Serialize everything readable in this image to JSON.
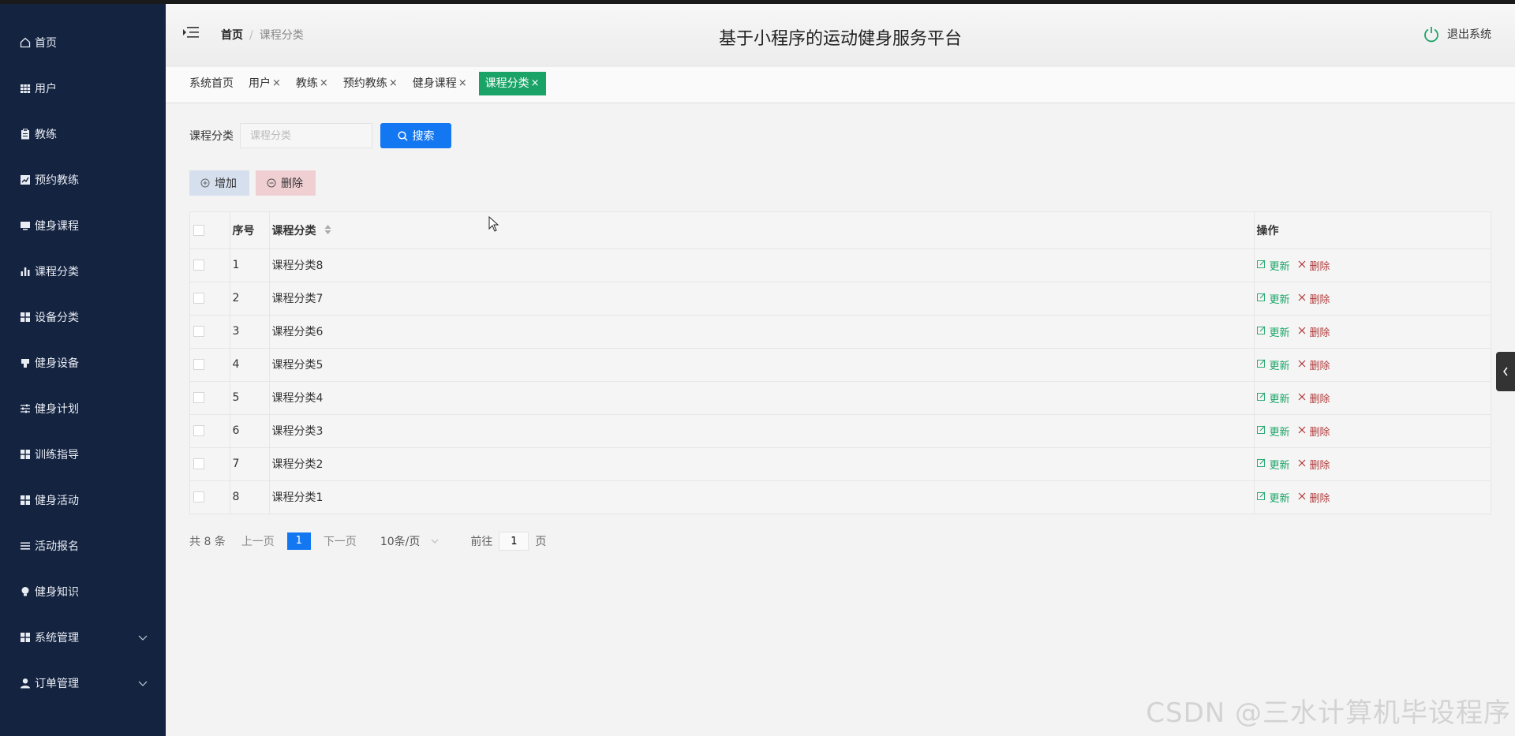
{
  "app_title": "基于小程序的运动健身服务平台",
  "breadcrumb": {
    "home": "首页",
    "separator": "/",
    "current": "课程分类"
  },
  "logout_label": "退出系统",
  "sidebar": {
    "items": [
      {
        "label": "首页",
        "icon": "home-icon"
      },
      {
        "label": "用户",
        "icon": "grid-icon"
      },
      {
        "label": "教练",
        "icon": "clipboard-icon"
      },
      {
        "label": "预约教练",
        "icon": "chart-icon"
      },
      {
        "label": "健身课程",
        "icon": "monitor-icon"
      },
      {
        "label": "课程分类",
        "icon": "bar-chart-icon"
      },
      {
        "label": "设备分类",
        "icon": "apps-icon"
      },
      {
        "label": "健身设备",
        "icon": "cup-icon"
      },
      {
        "label": "健身计划",
        "icon": "sliders-icon"
      },
      {
        "label": "训练指导",
        "icon": "apps-icon"
      },
      {
        "label": "健身活动",
        "icon": "apps-icon"
      },
      {
        "label": "活动报名",
        "icon": "list-icon"
      },
      {
        "label": "健身知识",
        "icon": "bulb-icon"
      },
      {
        "label": "系统管理",
        "icon": "apps-icon"
      },
      {
        "label": "订单管理",
        "icon": "user-icon"
      }
    ]
  },
  "tabs": [
    {
      "label": "系统首页",
      "closable": false,
      "active": false
    },
    {
      "label": "用户",
      "closable": true,
      "active": false
    },
    {
      "label": "教练",
      "closable": true,
      "active": false
    },
    {
      "label": "预约教练",
      "closable": true,
      "active": false
    },
    {
      "label": "健身课程",
      "closable": true,
      "active": false
    },
    {
      "label": "课程分类",
      "closable": true,
      "active": true
    }
  ],
  "tab_close_glyph": "×",
  "search": {
    "label": "课程分类",
    "placeholder": "课程分类",
    "value": "",
    "button": "搜索"
  },
  "actions": {
    "add": "增加",
    "delete": "删除"
  },
  "table": {
    "headers": {
      "index": "序号",
      "category": "课程分类",
      "ops": "操作"
    },
    "rows": [
      {
        "index": "1",
        "category": "课程分类8"
      },
      {
        "index": "2",
        "category": "课程分类7"
      },
      {
        "index": "3",
        "category": "课程分类6"
      },
      {
        "index": "4",
        "category": "课程分类5"
      },
      {
        "index": "5",
        "category": "课程分类4"
      },
      {
        "index": "6",
        "category": "课程分类3"
      },
      {
        "index": "7",
        "category": "课程分类2"
      },
      {
        "index": "8",
        "category": "课程分类1"
      }
    ],
    "row_update": "更新",
    "row_delete": "删除"
  },
  "pagination": {
    "total": "共 8 条",
    "prev": "上一页",
    "current_page": "1",
    "next": "下一页",
    "page_size": "10条/页",
    "goto_label": "前往",
    "goto_value": "1",
    "goto_suffix": "页"
  },
  "watermark": "CSDN @三水计算机毕设程序",
  "colors": {
    "sidebar": "#142340",
    "primary": "#1477f2",
    "active_tab": "#1aa367",
    "update": "#1aa367",
    "delete": "#b23a3a"
  }
}
